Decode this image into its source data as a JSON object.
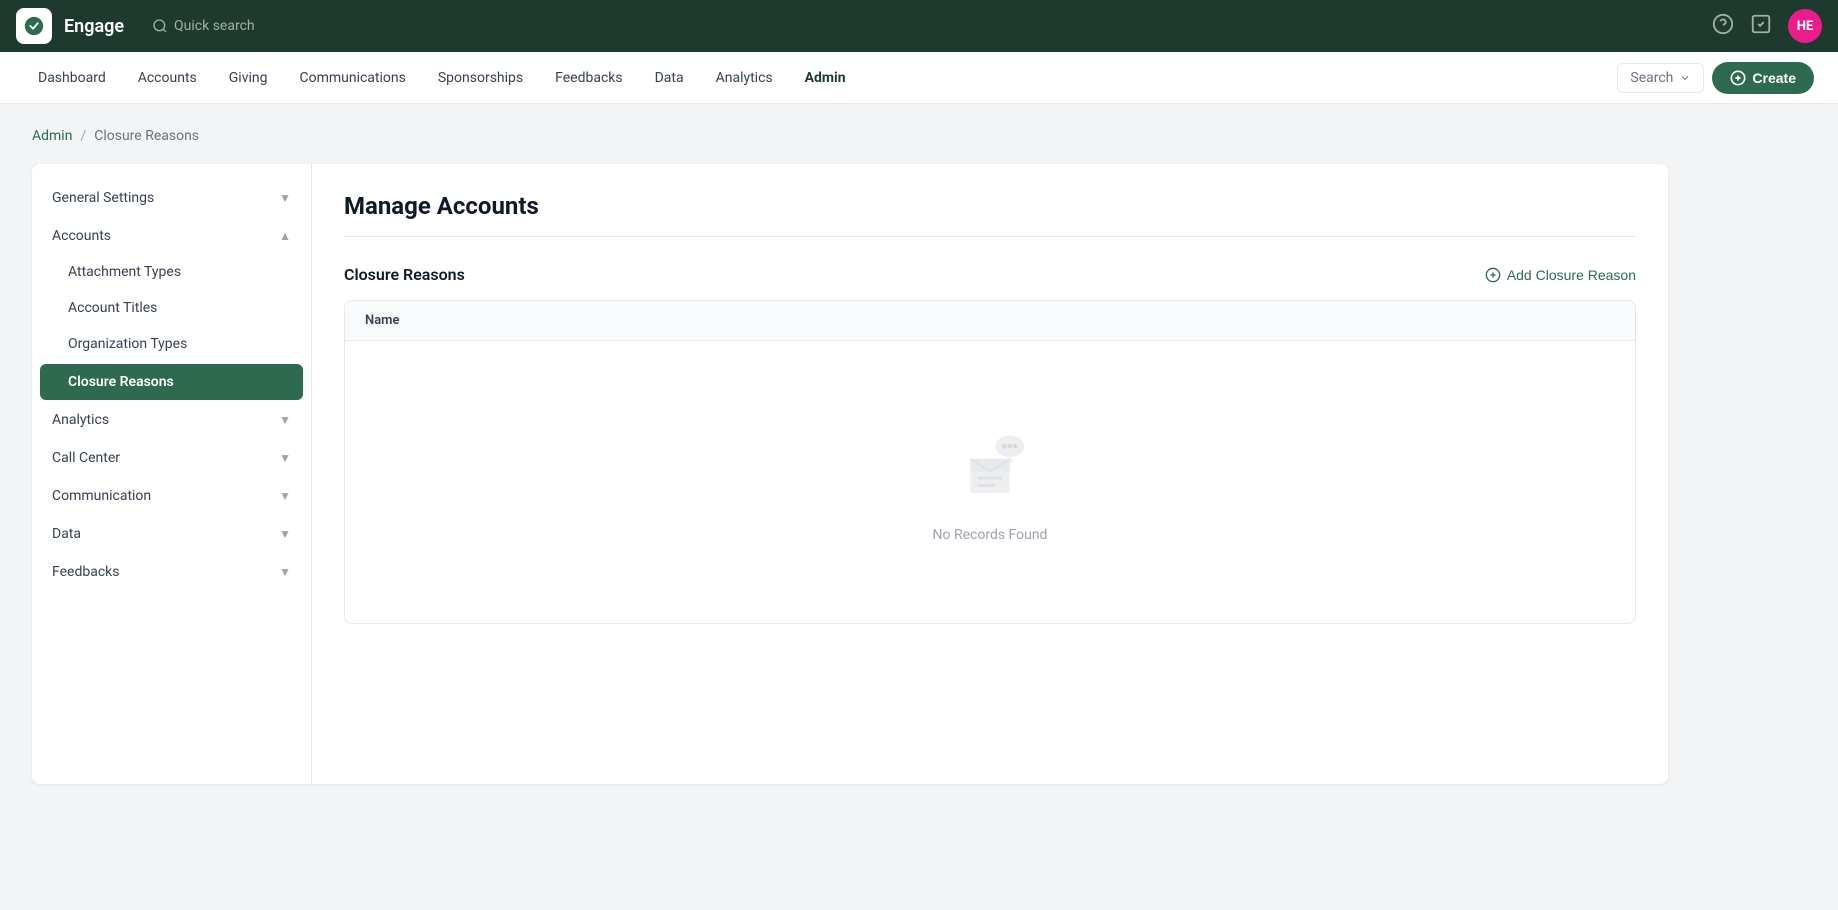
{
  "topbar": {
    "app_name": "Engage",
    "search_placeholder": "Quick search",
    "user_initials": "HE"
  },
  "navbar": {
    "items": [
      {
        "label": "Dashboard",
        "active": false
      },
      {
        "label": "Accounts",
        "active": false
      },
      {
        "label": "Giving",
        "active": false
      },
      {
        "label": "Communications",
        "active": false
      },
      {
        "label": "Sponsorships",
        "active": false
      },
      {
        "label": "Feedbacks",
        "active": false
      },
      {
        "label": "Data",
        "active": false
      },
      {
        "label": "Analytics",
        "active": false
      },
      {
        "label": "Admin",
        "active": true
      }
    ],
    "search_label": "Search",
    "create_label": "Create"
  },
  "breadcrumb": {
    "parent": "Admin",
    "current": "Closure Reasons"
  },
  "sidebar": {
    "groups": [
      {
        "label": "General Settings",
        "expanded": false,
        "items": []
      },
      {
        "label": "Accounts",
        "expanded": true,
        "items": [
          {
            "label": "Attachment Types",
            "active": false
          },
          {
            "label": "Account Titles",
            "active": false
          },
          {
            "label": "Organization Types",
            "active": false
          },
          {
            "label": "Closure Reasons",
            "active": true
          }
        ]
      },
      {
        "label": "Analytics",
        "expanded": false,
        "items": []
      },
      {
        "label": "Call Center",
        "expanded": false,
        "items": []
      },
      {
        "label": "Communication",
        "expanded": false,
        "items": []
      },
      {
        "label": "Data",
        "expanded": false,
        "items": []
      },
      {
        "label": "Feedbacks",
        "expanded": false,
        "items": []
      }
    ]
  },
  "content": {
    "page_title": "Manage Accounts",
    "section_title": "Closure Reasons",
    "add_button": "Add Closure Reason",
    "table": {
      "columns": [
        "Name"
      ],
      "empty_text": "No Records Found"
    }
  }
}
